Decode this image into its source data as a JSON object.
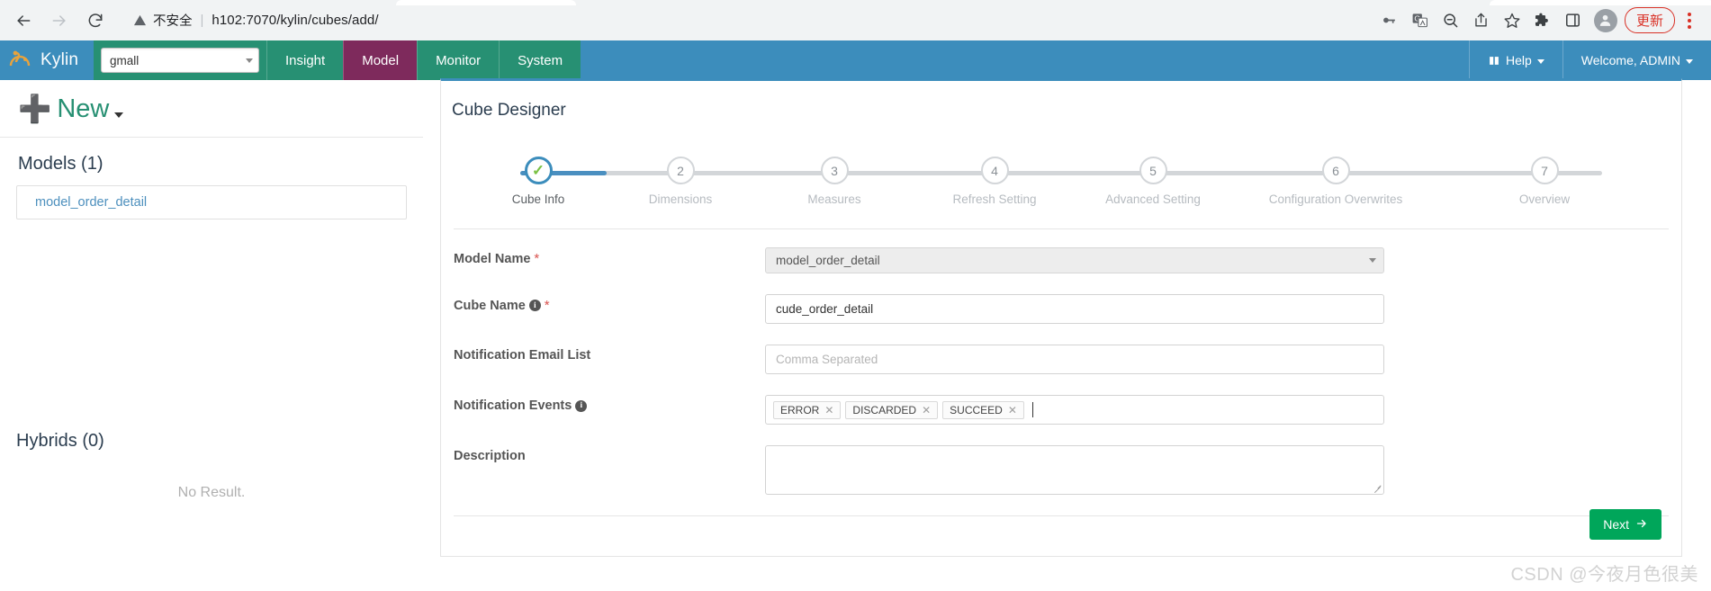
{
  "browser": {
    "back_icon": "back-arrow-icon",
    "forward_icon": "forward-arrow-icon",
    "reload_icon": "reload-icon",
    "security_warning_icon": "warning-triangle-icon",
    "security_text": "不安全",
    "separator": "|",
    "url": "h102:7070/kylin/cubes/add/",
    "url_host": "h102:7070",
    "url_path": "/kylin/cubes/add/",
    "toolbar_icons": [
      "password-key-icon",
      "translate-icon",
      "zoom-out-icon",
      "share-icon",
      "bookmark-star-icon",
      "extensions-puzzle-icon",
      "side-panel-icon",
      "profile-avatar-icon"
    ],
    "update_label": "更新",
    "menu_icon": "kebab-menu-icon"
  },
  "navbar": {
    "brand": "Kylin",
    "brand_logo": "kylin-logo-icon",
    "project_selected": "gmall",
    "project_caret_icon": "chevron-down-icon",
    "items": [
      {
        "label": "Insight",
        "active": false
      },
      {
        "label": "Model",
        "active": true
      },
      {
        "label": "Monitor",
        "active": false
      },
      {
        "label": "System",
        "active": false
      }
    ],
    "help_label": "Help",
    "help_icon": "book-icon",
    "user_label": "Welcome, ADMIN",
    "accent_blue": "#3c8dbc",
    "accent_green": "#279073",
    "accent_active": "#7e2a5c"
  },
  "sidebar": {
    "new_label": "New",
    "new_icon": "plus-icon",
    "models_heading": "Models (1)",
    "models": [
      {
        "name": "model_order_detail"
      }
    ],
    "hybrids_heading": "Hybrids (0)",
    "no_result": "No Result."
  },
  "panel": {
    "title": "Cube Designer",
    "steps": [
      {
        "num": "1",
        "label": "Cube Info",
        "state": "done"
      },
      {
        "num": "2",
        "label": "Dimensions",
        "state": "pending"
      },
      {
        "num": "3",
        "label": "Measures",
        "state": "pending"
      },
      {
        "num": "4",
        "label": "Refresh Setting",
        "state": "pending"
      },
      {
        "num": "5",
        "label": "Advanced Setting",
        "state": "pending"
      },
      {
        "num": "6",
        "label": "Configuration Overwrites",
        "state": "pending"
      },
      {
        "num": "7",
        "label": "Overview",
        "state": "pending"
      }
    ],
    "form": {
      "model_name_label": "Model Name",
      "model_name_value": "model_order_detail",
      "cube_name_label": "Cube Name",
      "cube_name_value": "cude_order_detail",
      "notification_email_label": "Notification Email List",
      "notification_email_placeholder": "Comma Separated",
      "notification_events_label": "Notification Events",
      "notification_events": [
        "ERROR",
        "DISCARDED",
        "SUCCEED"
      ],
      "description_label": "Description",
      "description_value": "",
      "required_mark": "*",
      "info_mark": "i",
      "tag_remove_icon": "close-x-icon"
    },
    "next_label": "Next",
    "next_icon": "arrow-right-icon"
  },
  "watermark": "CSDN @今夜月色很美"
}
